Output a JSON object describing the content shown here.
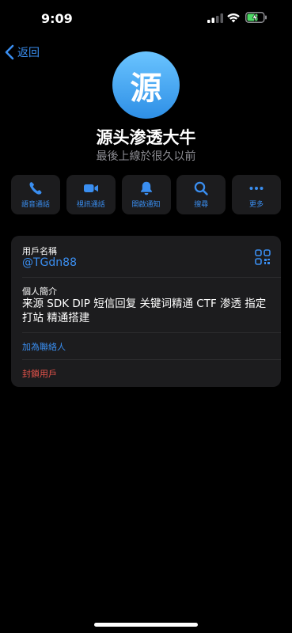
{
  "status_bar": {
    "time": "9:09"
  },
  "nav": {
    "back_label": "返回"
  },
  "profile": {
    "avatar_initial": "源",
    "name": "源头渗透大牛",
    "last_seen": "最後上線於很久以前"
  },
  "actions": [
    {
      "label": "語音通話",
      "icon": "phone-icon"
    },
    {
      "label": "視訊通話",
      "icon": "video-icon"
    },
    {
      "label": "開啟通知",
      "icon": "bell-icon"
    },
    {
      "label": "搜尋",
      "icon": "search-icon"
    },
    {
      "label": "更多",
      "icon": "more-icon"
    }
  ],
  "info": {
    "username_label": "用戶名稱",
    "username": "@TGdn88",
    "bio_label": "個人簡介",
    "bio": "来源 SDK DIP 短信回复 关键词精通 CTF 渗透 指定打站 精通搭建",
    "add_contact": "加為聯絡人",
    "block_user": "封鎖用戶"
  },
  "colors": {
    "accent": "#3a8ef0",
    "danger": "#e5534b",
    "card": "#1c1c1e",
    "secondary_text": "#8d8d93"
  }
}
